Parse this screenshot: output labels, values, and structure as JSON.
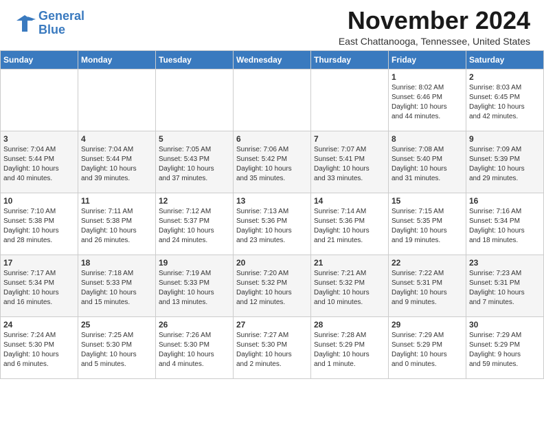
{
  "header": {
    "logo_line1": "General",
    "logo_line2": "Blue",
    "month": "November 2024",
    "location": "East Chattanooga, Tennessee, United States"
  },
  "days_of_week": [
    "Sunday",
    "Monday",
    "Tuesday",
    "Wednesday",
    "Thursday",
    "Friday",
    "Saturday"
  ],
  "weeks": [
    [
      {
        "day": "",
        "info": ""
      },
      {
        "day": "",
        "info": ""
      },
      {
        "day": "",
        "info": ""
      },
      {
        "day": "",
        "info": ""
      },
      {
        "day": "",
        "info": ""
      },
      {
        "day": "1",
        "info": "Sunrise: 8:02 AM\nSunset: 6:46 PM\nDaylight: 10 hours\nand 44 minutes."
      },
      {
        "day": "2",
        "info": "Sunrise: 8:03 AM\nSunset: 6:45 PM\nDaylight: 10 hours\nand 42 minutes."
      }
    ],
    [
      {
        "day": "3",
        "info": "Sunrise: 7:04 AM\nSunset: 5:44 PM\nDaylight: 10 hours\nand 40 minutes."
      },
      {
        "day": "4",
        "info": "Sunrise: 7:04 AM\nSunset: 5:44 PM\nDaylight: 10 hours\nand 39 minutes."
      },
      {
        "day": "5",
        "info": "Sunrise: 7:05 AM\nSunset: 5:43 PM\nDaylight: 10 hours\nand 37 minutes."
      },
      {
        "day": "6",
        "info": "Sunrise: 7:06 AM\nSunset: 5:42 PM\nDaylight: 10 hours\nand 35 minutes."
      },
      {
        "day": "7",
        "info": "Sunrise: 7:07 AM\nSunset: 5:41 PM\nDaylight: 10 hours\nand 33 minutes."
      },
      {
        "day": "8",
        "info": "Sunrise: 7:08 AM\nSunset: 5:40 PM\nDaylight: 10 hours\nand 31 minutes."
      },
      {
        "day": "9",
        "info": "Sunrise: 7:09 AM\nSunset: 5:39 PM\nDaylight: 10 hours\nand 29 minutes."
      }
    ],
    [
      {
        "day": "10",
        "info": "Sunrise: 7:10 AM\nSunset: 5:38 PM\nDaylight: 10 hours\nand 28 minutes."
      },
      {
        "day": "11",
        "info": "Sunrise: 7:11 AM\nSunset: 5:38 PM\nDaylight: 10 hours\nand 26 minutes."
      },
      {
        "day": "12",
        "info": "Sunrise: 7:12 AM\nSunset: 5:37 PM\nDaylight: 10 hours\nand 24 minutes."
      },
      {
        "day": "13",
        "info": "Sunrise: 7:13 AM\nSunset: 5:36 PM\nDaylight: 10 hours\nand 23 minutes."
      },
      {
        "day": "14",
        "info": "Sunrise: 7:14 AM\nSunset: 5:36 PM\nDaylight: 10 hours\nand 21 minutes."
      },
      {
        "day": "15",
        "info": "Sunrise: 7:15 AM\nSunset: 5:35 PM\nDaylight: 10 hours\nand 19 minutes."
      },
      {
        "day": "16",
        "info": "Sunrise: 7:16 AM\nSunset: 5:34 PM\nDaylight: 10 hours\nand 18 minutes."
      }
    ],
    [
      {
        "day": "17",
        "info": "Sunrise: 7:17 AM\nSunset: 5:34 PM\nDaylight: 10 hours\nand 16 minutes."
      },
      {
        "day": "18",
        "info": "Sunrise: 7:18 AM\nSunset: 5:33 PM\nDaylight: 10 hours\nand 15 minutes."
      },
      {
        "day": "19",
        "info": "Sunrise: 7:19 AM\nSunset: 5:33 PM\nDaylight: 10 hours\nand 13 minutes."
      },
      {
        "day": "20",
        "info": "Sunrise: 7:20 AM\nSunset: 5:32 PM\nDaylight: 10 hours\nand 12 minutes."
      },
      {
        "day": "21",
        "info": "Sunrise: 7:21 AM\nSunset: 5:32 PM\nDaylight: 10 hours\nand 10 minutes."
      },
      {
        "day": "22",
        "info": "Sunrise: 7:22 AM\nSunset: 5:31 PM\nDaylight: 10 hours\nand 9 minutes."
      },
      {
        "day": "23",
        "info": "Sunrise: 7:23 AM\nSunset: 5:31 PM\nDaylight: 10 hours\nand 7 minutes."
      }
    ],
    [
      {
        "day": "24",
        "info": "Sunrise: 7:24 AM\nSunset: 5:30 PM\nDaylight: 10 hours\nand 6 minutes."
      },
      {
        "day": "25",
        "info": "Sunrise: 7:25 AM\nSunset: 5:30 PM\nDaylight: 10 hours\nand 5 minutes."
      },
      {
        "day": "26",
        "info": "Sunrise: 7:26 AM\nSunset: 5:30 PM\nDaylight: 10 hours\nand 4 minutes."
      },
      {
        "day": "27",
        "info": "Sunrise: 7:27 AM\nSunset: 5:30 PM\nDaylight: 10 hours\nand 2 minutes."
      },
      {
        "day": "28",
        "info": "Sunrise: 7:28 AM\nSunset: 5:29 PM\nDaylight: 10 hours\nand 1 minute."
      },
      {
        "day": "29",
        "info": "Sunrise: 7:29 AM\nSunset: 5:29 PM\nDaylight: 10 hours\nand 0 minutes."
      },
      {
        "day": "30",
        "info": "Sunrise: 7:29 AM\nSunset: 5:29 PM\nDaylight: 9 hours\nand 59 minutes."
      }
    ]
  ]
}
